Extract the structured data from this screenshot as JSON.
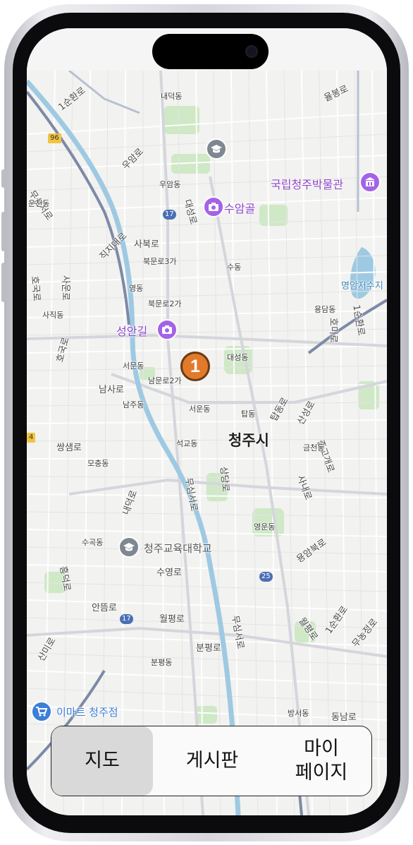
{
  "map": {
    "city_label": "청주시",
    "marker_label": "1",
    "pois": {
      "museum": "국립청주박물관",
      "suamgol": "수암골",
      "seongangil": "성안길",
      "university": "청주교육대학교",
      "emart": "이마트 청주점",
      "reservoir": "명암저수지"
    },
    "road_labels": {
      "r1": "1순환로",
      "r2": "율봉로",
      "r3": "우암로",
      "r4": "무심서로",
      "r5": "직지대로",
      "r6": "대성로",
      "r7": "사북로",
      "r8": "호국로",
      "r9": "사운로",
      "r10": "남사로",
      "r11": "쌍샘로",
      "r12": "1순환로",
      "r13": "호미로",
      "r14": "탑동로",
      "r15": "산성로",
      "r16": "중고개로",
      "r17": "상당로",
      "r18": "사내로",
      "r19": "용암북로",
      "r20": "무심서로",
      "r21": "내덕로",
      "r22": "흥덕로",
      "r23": "수영로",
      "r24": "안뜸로",
      "r25": "월평로",
      "r26": "분평로",
      "r27": "무심서로",
      "r28": "월평로",
      "r29": "1순환로",
      "r30": "무농정로",
      "r31": "산미로",
      "r32": "동남로"
    },
    "area_labels": {
      "a1": "내덕동",
      "a2": "우암동",
      "a3": "운천동",
      "a4": "북문로3가",
      "a5": "수동",
      "a6": "영동",
      "a7": "북문로2가",
      "a8": "용담동",
      "a9": "사직동",
      "a10": "서문동",
      "a11": "남문로2가",
      "a12": "대성동",
      "a13": "남주동",
      "a14": "서운동",
      "a15": "탑동",
      "a16": "석교동",
      "a17": "금천동",
      "a18": "모충동",
      "a19": "영운동",
      "a20": "수곡동",
      "a21": "분평동",
      "a22": "방서동"
    },
    "route_shields": {
      "s96": "96",
      "s17a": "17",
      "s17b": "17",
      "s25": "25",
      "s4": "4"
    }
  },
  "tabbar": {
    "tab_map": "지도",
    "tab_board": "게시판",
    "tab_mypage": "마이\n페이지",
    "active": "tab_map"
  },
  "colors": {
    "frame": "#0b0b0d",
    "map_background": "#f2f2f0",
    "park": "#cfe8c6",
    "river": "#9ec9e2",
    "major_road": "#7d8aa6",
    "marker": "#e27a2b",
    "poi_purple": "#a463e6",
    "tab_active": "#d9d9d9"
  }
}
